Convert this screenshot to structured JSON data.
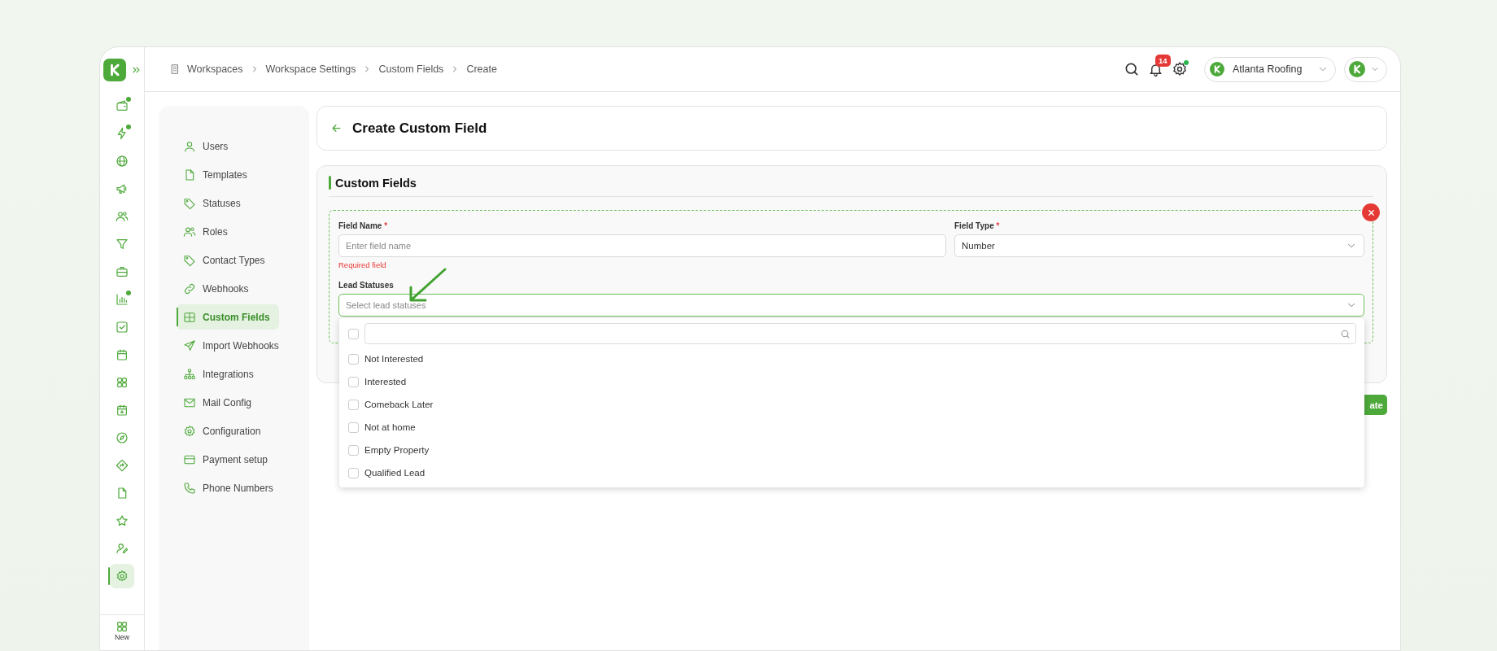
{
  "topbar": {
    "breadcrumb": [
      {
        "label": "Workspaces"
      },
      {
        "label": "Workspace Settings"
      },
      {
        "label": "Custom Fields"
      },
      {
        "label": "Create"
      }
    ],
    "notification_count": "14",
    "settings_dot": true,
    "workspace": "Atlanta Roofing"
  },
  "rail": {
    "items": [
      {
        "dot": true,
        "selected": false
      },
      {
        "dot": true,
        "selected": false
      },
      {
        "dot": false,
        "selected": false
      },
      {
        "dot": false,
        "selected": false
      },
      {
        "dot": false,
        "selected": false
      },
      {
        "dot": false,
        "selected": false
      },
      {
        "dot": false,
        "selected": false
      },
      {
        "dot": true,
        "selected": false
      },
      {
        "dot": false,
        "selected": false
      },
      {
        "dot": false,
        "selected": false
      },
      {
        "dot": false,
        "selected": false
      },
      {
        "dot": false,
        "selected": false
      },
      {
        "dot": false,
        "selected": false
      },
      {
        "dot": false,
        "selected": false
      },
      {
        "dot": false,
        "selected": false
      },
      {
        "dot": false,
        "selected": false
      },
      {
        "dot": false,
        "selected": false
      },
      {
        "dot": false,
        "selected": true
      }
    ],
    "new_label": "New"
  },
  "settings_nav": [
    {
      "label": "Users",
      "selected": false
    },
    {
      "label": "Templates",
      "selected": false
    },
    {
      "label": "Statuses",
      "selected": false
    },
    {
      "label": "Roles",
      "selected": false
    },
    {
      "label": "Contact Types",
      "selected": false
    },
    {
      "label": "Webhooks",
      "selected": false
    },
    {
      "label": "Custom Fields",
      "selected": true
    },
    {
      "label": "Import Webhooks",
      "selected": false
    },
    {
      "label": "Integrations",
      "selected": false
    },
    {
      "label": "Mail Config",
      "selected": false
    },
    {
      "label": "Configuration",
      "selected": false
    },
    {
      "label": "Payment setup",
      "selected": false
    },
    {
      "label": "Phone Numbers",
      "selected": false
    }
  ],
  "page": {
    "title": "Create Custom Field"
  },
  "section": {
    "title": "Custom Fields"
  },
  "form": {
    "field_name": {
      "label": "Field Name",
      "required_mark": "*",
      "placeholder": "Enter field name",
      "error": "Required field"
    },
    "field_type": {
      "label": "Field Type",
      "required_mark": "*",
      "value": "Number"
    },
    "lead_statuses": {
      "label": "Lead Statuses",
      "placeholder": "Select lead statuses",
      "expanded": true,
      "select_all": {
        "checked": false
      },
      "options": [
        {
          "label": "Not Interested",
          "checked": false
        },
        {
          "label": "Interested",
          "checked": false
        },
        {
          "label": "Comeback Later",
          "checked": false
        },
        {
          "label": "Not at home",
          "checked": false
        },
        {
          "label": "Empty Property",
          "checked": false
        },
        {
          "label": "Qualified Lead",
          "checked": false
        }
      ]
    }
  },
  "create_button": {
    "label": "ate"
  }
}
